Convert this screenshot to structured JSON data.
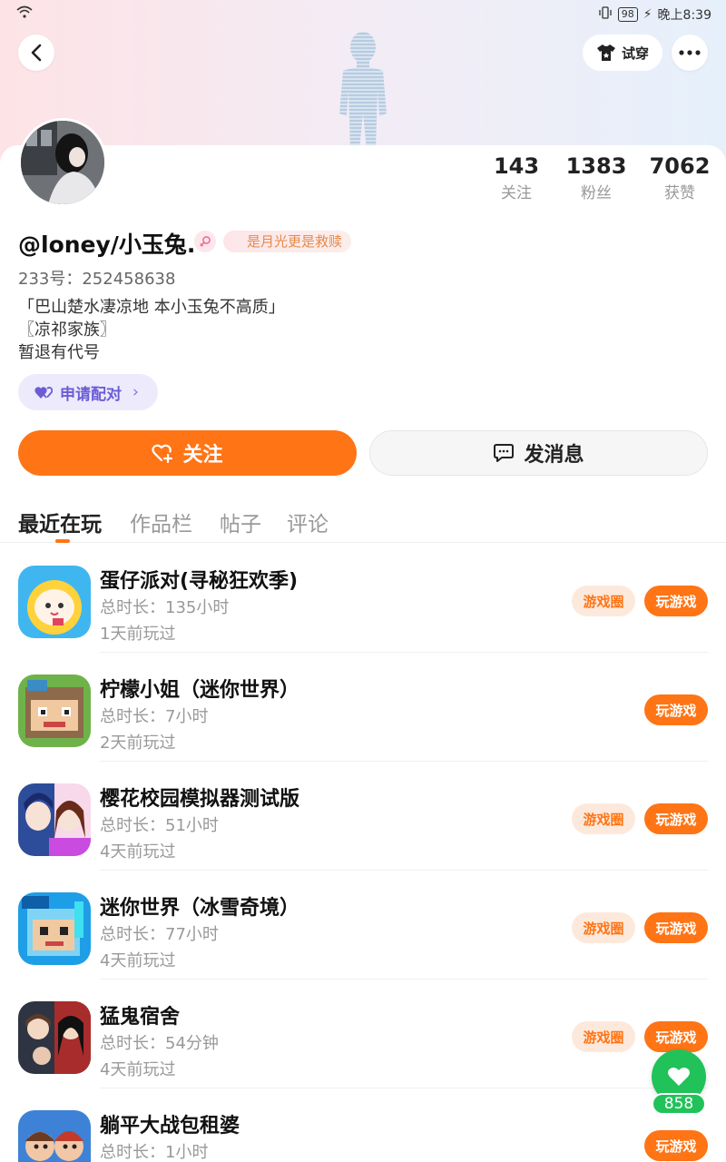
{
  "status_bar": {
    "battery": "98",
    "time": "晚上8:39"
  },
  "header": {
    "tryon_label": "试穿"
  },
  "profile": {
    "stats": [
      {
        "value": "143",
        "label": "关注"
      },
      {
        "value": "1383",
        "label": "粉丝"
      },
      {
        "value": "7062",
        "label": "获赞"
      }
    ],
    "nickname": "@loney/小玉兔.",
    "tag": "是月光更是救赎",
    "uid": "233号：252458638",
    "bio": [
      "「巴山楚水凄凉地 本小玉兔不高质」",
      "〖凉祁家族〗",
      "暂退有代号"
    ],
    "pair_label": "申请配对"
  },
  "actions": {
    "follow_label": "关注",
    "message_label": "发消息"
  },
  "tabs": [
    "最近在玩",
    "作品栏",
    "帖子",
    "评论"
  ],
  "games": [
    {
      "name": "蛋仔派对(寻秘狂欢季)",
      "duration": "总时长：135小时",
      "last_played": "1天前玩过",
      "circle": "游戏圈",
      "play": "玩游戏"
    },
    {
      "name": "柠檬小姐（迷你世界）",
      "duration": "总时长：7小时",
      "last_played": "2天前玩过",
      "circle": "",
      "play": "玩游戏"
    },
    {
      "name": "樱花校园模拟器测试版",
      "duration": "总时长：51小时",
      "last_played": "4天前玩过",
      "circle": "游戏圈",
      "play": "玩游戏"
    },
    {
      "name": "迷你世界（冰雪奇境）",
      "duration": "总时长：77小时",
      "last_played": "4天前玩过",
      "circle": "游戏圈",
      "play": "玩游戏"
    },
    {
      "name": "猛鬼宿舍",
      "duration": "总时长：54分钟",
      "last_played": "4天前玩过",
      "circle": "游戏圈",
      "play": "玩游戏"
    },
    {
      "name": "躺平大战包租婆",
      "duration": "总时长：1小时",
      "last_played": "",
      "circle": "",
      "play": "玩游戏"
    }
  ],
  "like_count": "858",
  "colors": {
    "accent": "#ff7415",
    "like": "#21c25a",
    "pair": "#6b5cd6"
  }
}
